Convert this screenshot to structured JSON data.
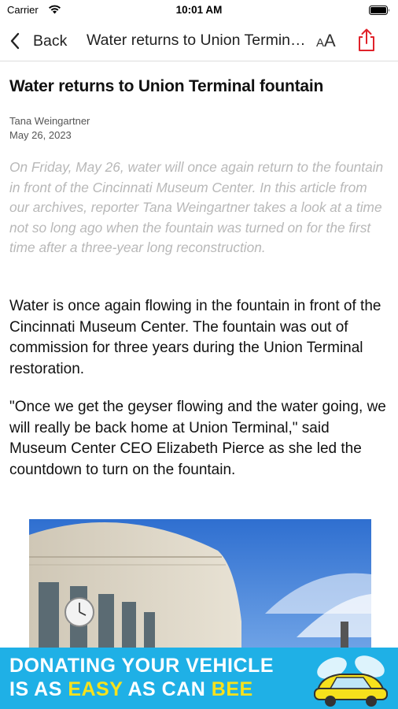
{
  "status_bar": {
    "carrier": "Carrier",
    "time": "10:01 AM"
  },
  "nav": {
    "back_label": "Back",
    "title": "Water returns to Union Terminal fountain",
    "text_size_small": "A",
    "text_size_large": "A"
  },
  "article": {
    "headline": "Water returns to Union Terminal fountain",
    "author": "Tana Weingartner",
    "date": "May 26, 2023",
    "intro": "On Friday, May 26, water will once again return to the fountain in front of the Cincinnati Museum Center. In this article from our archives, reporter Tana Weingartner takes a look at a time not so long ago when the fountain was turned on for the first time after a three-year long reconstruction.",
    "paragraphs": [
      "Water is once again flowing in the fountain in front of the Cincinnati Museum Center. The fountain was out of commission for three years during the Union Terminal restoration.",
      "\"Once we get the geyser flowing and the water going, we will really be back home at Union Terminal,\" said Museum Center CEO Elizabeth Pierce as she led the countdown to turn on the fountain."
    ]
  },
  "ad": {
    "line1": "DONATING YOUR VEHICLE",
    "line2_part1": "IS AS ",
    "line2_highlight1": "EASY",
    "line2_part2": " AS CAN ",
    "line2_highlight2": "BEE",
    "bg_color": "#1fb0e6",
    "highlight_color": "#f7e11c"
  },
  "colors": {
    "share_icon": "#e0222a",
    "intro_text": "#b8b8b8"
  }
}
